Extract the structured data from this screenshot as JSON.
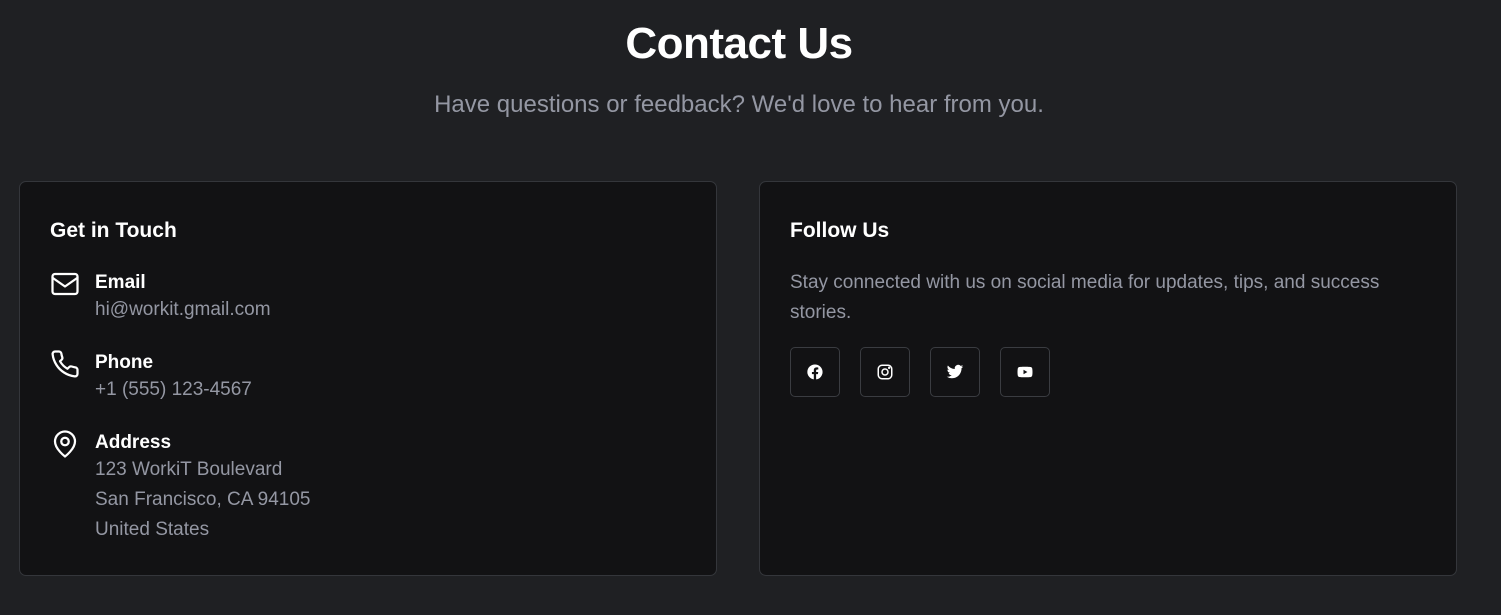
{
  "header": {
    "title": "Contact Us",
    "subtitle": "Have questions or feedback? We'd love to hear from you."
  },
  "get_in_touch": {
    "title": "Get in Touch",
    "email": {
      "label": "Email",
      "value": "hi@workit.gmail.com",
      "icon": "mail-icon"
    },
    "phone": {
      "label": "Phone",
      "value": "+1 (555) 123-4567",
      "icon": "phone-icon"
    },
    "address": {
      "label": "Address",
      "lines": [
        "123 WorkiT Boulevard",
        "San Francisco, CA 94105",
        "United States"
      ],
      "icon": "map-pin-icon"
    }
  },
  "follow_us": {
    "title": "Follow Us",
    "text": "Stay connected with us on social media for updates, tips, and success stories.",
    "social": [
      {
        "name": "facebook",
        "icon": "facebook-icon"
      },
      {
        "name": "instagram",
        "icon": "instagram-icon"
      },
      {
        "name": "twitter",
        "icon": "twitter-icon"
      },
      {
        "name": "youtube",
        "icon": "youtube-icon"
      }
    ]
  },
  "colors": {
    "background": "#1f2023",
    "card": "#121214",
    "card_border": "#34363b",
    "text_primary": "#ffffff",
    "text_muted": "#9497a3"
  }
}
